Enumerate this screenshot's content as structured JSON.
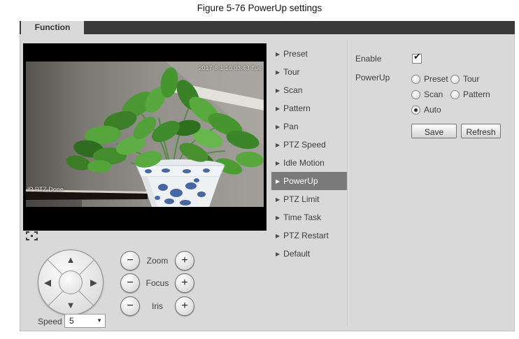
{
  "page": {
    "caption": "Figure 5-76 PowerUp settings"
  },
  "tab_bar": {
    "active_tab": "Function"
  },
  "video": {
    "timestamp": "2017-8-1 10:03:43 Tue",
    "status_osd": "IP PTZ Done"
  },
  "ptz_menu": {
    "items": [
      {
        "label": "Preset",
        "active": false
      },
      {
        "label": "Tour",
        "active": false
      },
      {
        "label": "Scan",
        "active": false
      },
      {
        "label": "Pattern",
        "active": false
      },
      {
        "label": "Pan",
        "active": false
      },
      {
        "label": "PTZ Speed",
        "active": false
      },
      {
        "label": "Idle Motion",
        "active": false
      },
      {
        "label": "PowerUp",
        "active": true
      },
      {
        "label": "PTZ Limit",
        "active": false
      },
      {
        "label": "Time Task",
        "active": false
      },
      {
        "label": "PTZ Restart",
        "active": false
      },
      {
        "label": "Default",
        "active": false
      }
    ]
  },
  "settings": {
    "enable": {
      "label": "Enable",
      "checked": true
    },
    "powerup": {
      "label": "PowerUp",
      "selected": "Auto",
      "option_rows": [
        [
          "Preset",
          "Tour"
        ],
        [
          "Scan",
          "Pattern"
        ],
        [
          "Auto"
        ]
      ]
    },
    "buttons": {
      "save": "Save",
      "refresh": "Refresh"
    }
  },
  "ptz_controls": {
    "speed": {
      "label": "Speed",
      "value": "5"
    },
    "axes": [
      {
        "label": "Zoom"
      },
      {
        "label": "Focus"
      },
      {
        "label": "Iris"
      }
    ]
  },
  "icons": {
    "menu_bullet": "▶",
    "checkmark": "✔",
    "dropdown_arrow": "▼",
    "minus": "−",
    "plus": "+",
    "dpad_up": "▲",
    "dpad_down": "▼",
    "dpad_left": "◀",
    "dpad_right": "▶"
  },
  "colors": {
    "tab_bar_bg": "#3a3a3a",
    "panel_bg": "#d9d9d9",
    "menu_active_bg": "#7a7a7a",
    "menu_active_text": "#ffffff",
    "osd_text": "#e4e4e4",
    "pot_blue": "#35599b",
    "leaf_green": "#46962f"
  }
}
